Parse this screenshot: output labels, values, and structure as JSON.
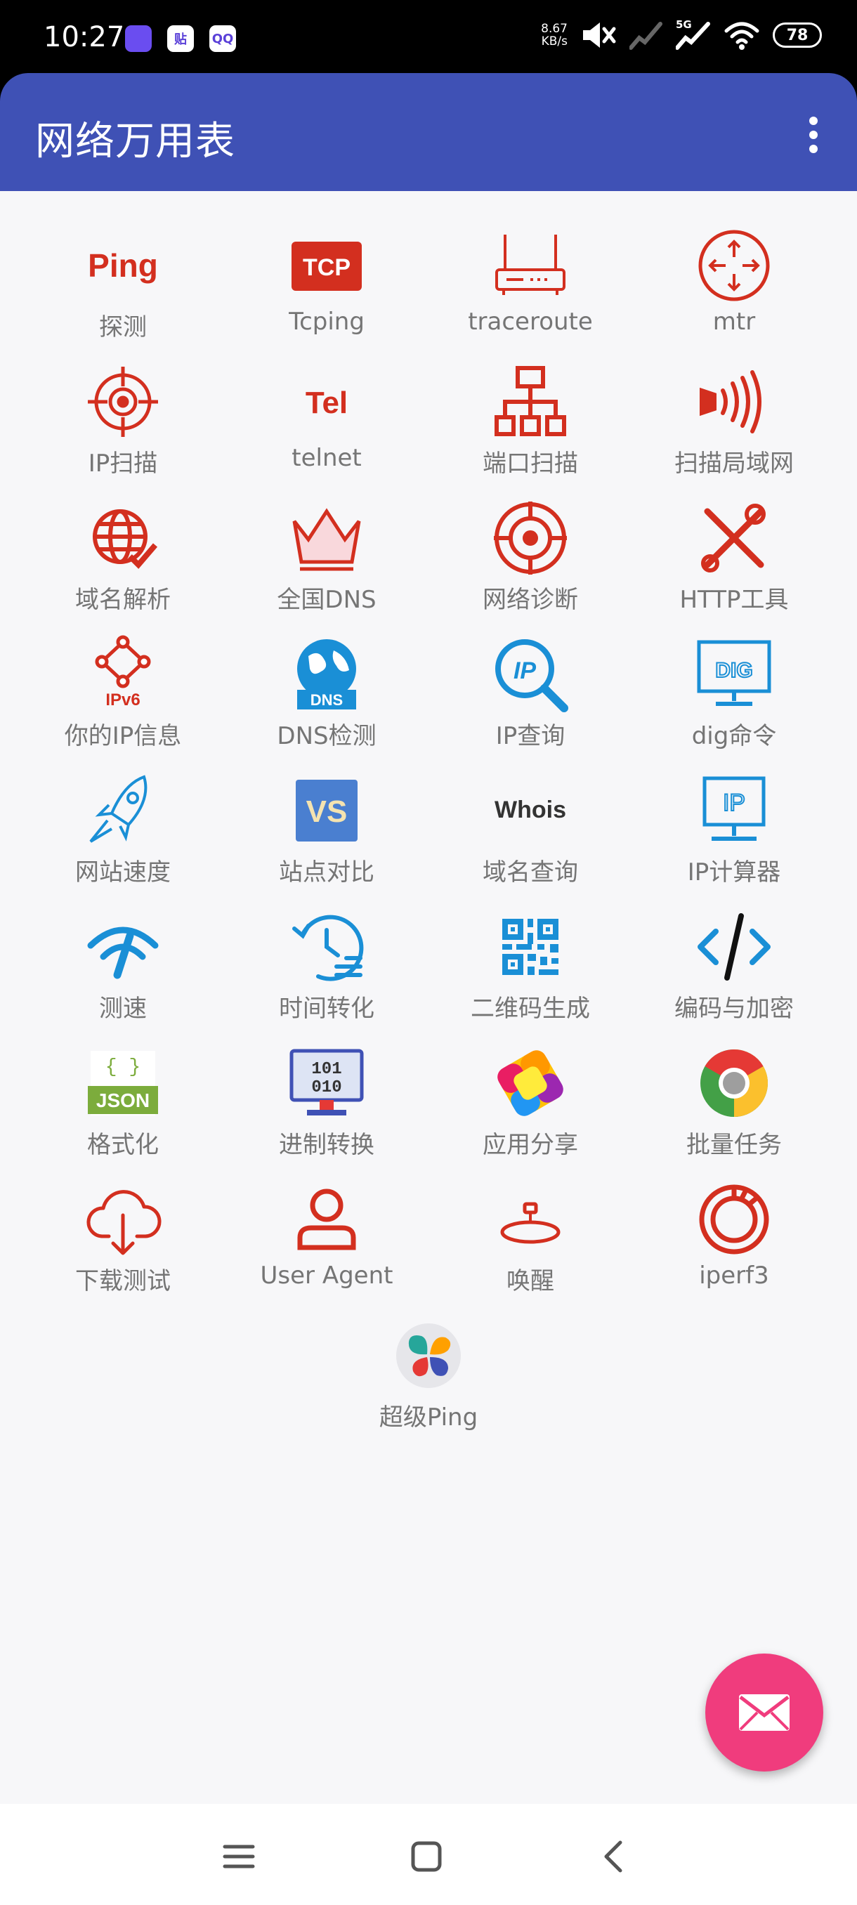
{
  "status_bar": {
    "time": "10:27",
    "apps": [
      "",
      "贴",
      "QQ"
    ],
    "speed_value": "8.67",
    "speed_unit": "KB/s",
    "network": "5G",
    "battery": "78"
  },
  "app_bar": {
    "title": "网络万用表",
    "menu_icon": "more-vert-icon"
  },
  "tools": [
    {
      "label": "探测",
      "icon": "ping-icon",
      "icon_text": "Ping",
      "color": "#d32f1f"
    },
    {
      "label": "Tcping",
      "icon": "tcp-icon",
      "icon_text": "TCP",
      "color": "#d32f1f"
    },
    {
      "label": "traceroute",
      "icon": "router-icon",
      "color": "#d32f1f"
    },
    {
      "label": "mtr",
      "icon": "mtr-icon",
      "color": "#d32f1f"
    },
    {
      "label": "IP扫描",
      "icon": "crosshair-icon",
      "color": "#d32f1f"
    },
    {
      "label": "telnet",
      "icon": "telnet-icon",
      "icon_text": "Tel",
      "color": "#d32f1f"
    },
    {
      "label": "端口扫描",
      "icon": "network-tree-icon",
      "color": "#d32f1f"
    },
    {
      "label": "扫描局域网",
      "icon": "signal-waves-icon",
      "color": "#d32f1f"
    },
    {
      "label": "域名解析",
      "icon": "globe-check-icon",
      "color": "#d32f1f"
    },
    {
      "label": "全国DNS",
      "icon": "crown-icon",
      "color": "#d32f1f"
    },
    {
      "label": "网络诊断",
      "icon": "target-icon",
      "color": "#d32f1f"
    },
    {
      "label": "HTTP工具",
      "icon": "tools-icon",
      "color": "#d32f1f"
    },
    {
      "label": "你的IP信息",
      "icon": "ipv6-icon",
      "icon_text": "IPv6",
      "color": "#d32f1f"
    },
    {
      "label": "DNS检测",
      "icon": "dns-globe-icon",
      "icon_text": "DNS",
      "color": "#1a8fd6"
    },
    {
      "label": "IP查询",
      "icon": "ip-search-icon",
      "icon_text": "IP",
      "color": "#1a8fd6"
    },
    {
      "label": "dig命令",
      "icon": "dig-monitor-icon",
      "icon_text": "DIG",
      "color": "#1a8fd6"
    },
    {
      "label": "网站速度",
      "icon": "rocket-icon",
      "color": "#1a8fd6"
    },
    {
      "label": "站点对比",
      "icon": "vs-icon",
      "icon_text": "VS",
      "color": "#4a7fd0"
    },
    {
      "label": "域名查询",
      "icon": "whois-icon",
      "icon_text": "Whois",
      "color": "#333333"
    },
    {
      "label": "IP计算器",
      "icon": "ip-monitor-icon",
      "icon_text": "IP",
      "color": "#1a8fd6"
    },
    {
      "label": "测速",
      "icon": "speedometer-icon",
      "color": "#1a8fd6"
    },
    {
      "label": "时间转化",
      "icon": "clock-history-icon",
      "color": "#1a8fd6"
    },
    {
      "label": "二维码生成",
      "icon": "qr-code-icon",
      "color": "#1a8fd6"
    },
    {
      "label": "编码与加密",
      "icon": "code-icon",
      "icon_text": "</>",
      "color": "#1a8fd6"
    },
    {
      "label": "格式化",
      "icon": "json-icon",
      "icon_text": "JSON",
      "color": "#7cac3c"
    },
    {
      "label": "进制转换",
      "icon": "binary-monitor-icon",
      "icon_text": "101",
      "icon_text2": "010",
      "color": "#3f51b5"
    },
    {
      "label": "应用分享",
      "icon": "share-app-icon",
      "color": "#ffc107"
    },
    {
      "label": "批量任务",
      "icon": "chrome-icon",
      "color": "#e53935"
    },
    {
      "label": "下载测试",
      "icon": "cloud-download-icon",
      "color": "#d32f1f"
    },
    {
      "label": "User Agent",
      "icon": "user-icon",
      "color": "#d32f1f"
    },
    {
      "label": "唤醒",
      "icon": "wake-icon",
      "color": "#d32f1f"
    },
    {
      "label": "iperf3",
      "icon": "iperf-icon",
      "color": "#d32f1f"
    }
  ],
  "extra_tool": {
    "label": "超级Ping",
    "icon": "super-ping-icon"
  },
  "fab": {
    "icon": "mail-icon",
    "color": "#f03c7d"
  },
  "nav_bar": {
    "menu": "menu-icon",
    "home": "home-icon",
    "back": "back-icon"
  }
}
